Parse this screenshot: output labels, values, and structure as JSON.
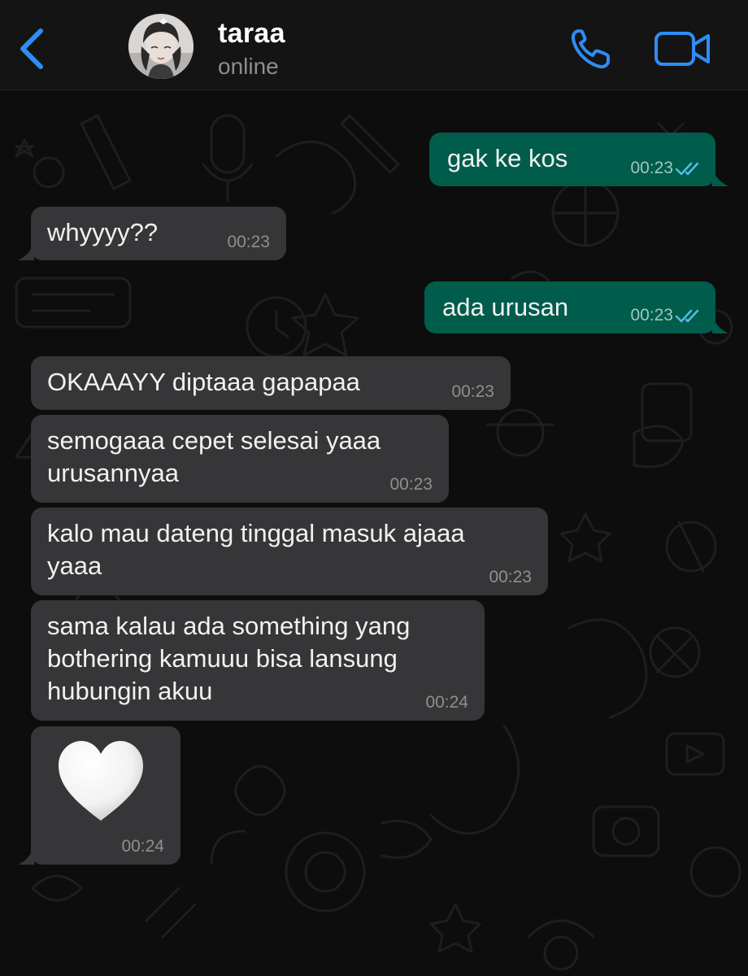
{
  "header": {
    "contact_name": "taraa",
    "status": "online",
    "icons": {
      "back": "chevron-left-icon",
      "call": "phone-icon",
      "video": "video-camera-icon"
    },
    "accent_color": "#2f8df5"
  },
  "messages": [
    {
      "direction": "outgoing",
      "text": "gak ke kos",
      "time": "00:23",
      "read": true
    },
    {
      "direction": "incoming",
      "text": "whyyyy??",
      "time": "00:23"
    },
    {
      "direction": "outgoing",
      "text": "ada urusan",
      "time": "00:23",
      "read": true
    },
    {
      "direction": "incoming",
      "text": "OKAAAYY diptaaa gapapaa",
      "time": "00:23"
    },
    {
      "direction": "incoming",
      "text": "semogaaa cepet selesai yaaa\nurusannyaa",
      "time": "00:23"
    },
    {
      "direction": "incoming",
      "text": "kalo mau dateng tinggal masuk ajaaa\nyaaa",
      "time": "00:23"
    },
    {
      "direction": "incoming",
      "text": "sama kalau ada something yang\nbothering kamuuu bisa lansung\nhubungin akuu",
      "time": "00:24"
    },
    {
      "direction": "incoming",
      "emoji": "white-heart-icon",
      "time": "00:24"
    }
  ],
  "colors": {
    "incoming_bubble": "#363638",
    "outgoing_bubble": "#005c4b",
    "read_ticks": "#53bdeb"
  }
}
